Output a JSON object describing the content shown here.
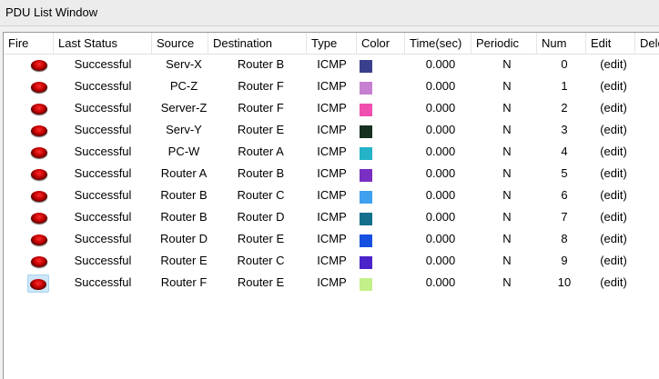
{
  "window": {
    "title": "PDU List Window"
  },
  "columns": [
    "Fire",
    "Last Status",
    "Source",
    "Destination",
    "Type",
    "Color",
    "Time(sec)",
    "Periodic",
    "Num",
    "Edit",
    "Delete"
  ],
  "rows": [
    {
      "status": "Successful",
      "source": "Serv-X",
      "destination": "Router B",
      "type": "ICMP",
      "color": "#3a3f8c",
      "time": "0.000",
      "periodic": "N",
      "num": "0",
      "edit": "(edit)"
    },
    {
      "status": "Successful",
      "source": "PC-Z",
      "destination": "Router F",
      "type": "ICMP",
      "color": "#c77fd1",
      "time": "0.000",
      "periodic": "N",
      "num": "1",
      "edit": "(edit)"
    },
    {
      "status": "Successful",
      "source": "Server-Z",
      "destination": "Router F",
      "type": "ICMP",
      "color": "#f04fb0",
      "time": "0.000",
      "periodic": "N",
      "num": "2",
      "edit": "(edit)"
    },
    {
      "status": "Successful",
      "source": "Serv-Y",
      "destination": "Router E",
      "type": "ICMP",
      "color": "#16311f",
      "time": "0.000",
      "periodic": "N",
      "num": "3",
      "edit": "(edit)"
    },
    {
      "status": "Successful",
      "source": "PC-W",
      "destination": "Router A",
      "type": "ICMP",
      "color": "#25b3c8",
      "time": "0.000",
      "periodic": "N",
      "num": "4",
      "edit": "(edit)"
    },
    {
      "status": "Successful",
      "source": "Router A",
      "destination": "Router B",
      "type": "ICMP",
      "color": "#7b2fc2",
      "time": "0.000",
      "periodic": "N",
      "num": "5",
      "edit": "(edit)"
    },
    {
      "status": "Successful",
      "source": "Router B",
      "destination": "Router C",
      "type": "ICMP",
      "color": "#3fa0f0",
      "time": "0.000",
      "periodic": "N",
      "num": "6",
      "edit": "(edit)"
    },
    {
      "status": "Successful",
      "source": "Router B",
      "destination": "Router D",
      "type": "ICMP",
      "color": "#136f8c",
      "time": "0.000",
      "periodic": "N",
      "num": "7",
      "edit": "(edit)"
    },
    {
      "status": "Successful",
      "source": "Router D",
      "destination": "Router E",
      "type": "ICMP",
      "color": "#1650e0",
      "time": "0.000",
      "periodic": "N",
      "num": "8",
      "edit": "(edit)"
    },
    {
      "status": "Successful",
      "source": "Router E",
      "destination": "Router C",
      "type": "ICMP",
      "color": "#4a23c9",
      "time": "0.000",
      "periodic": "N",
      "num": "9",
      "edit": "(edit)"
    },
    {
      "status": "Successful",
      "source": "Router F",
      "destination": "Router E",
      "type": "ICMP",
      "color": "#c3f08a",
      "time": "0.000",
      "periodic": "N",
      "num": "10",
      "edit": "(edit)"
    }
  ],
  "selected_row": 10
}
